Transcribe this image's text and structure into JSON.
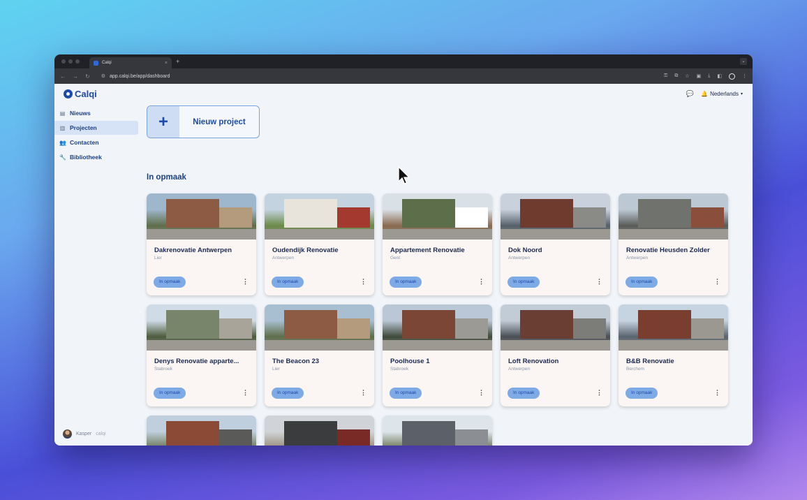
{
  "browser": {
    "tab_title": "Calqi",
    "tab_close": "×",
    "new_tab": "+",
    "url": "app.calqi.be/app/dashboard",
    "tabbar_menu": "⌄"
  },
  "app": {
    "logo": "Calqi",
    "nav": [
      {
        "label": "Nieuws",
        "icon": "newspaper-icon",
        "glyph": "▤"
      },
      {
        "label": "Projecten",
        "icon": "building-icon",
        "glyph": "▥",
        "active": true
      },
      {
        "label": "Contacten",
        "icon": "people-icon",
        "glyph": "👥"
      },
      {
        "label": "Bibliotheek",
        "icon": "wrench-icon",
        "glyph": "🔧"
      }
    ],
    "user": {
      "name": "Kasper",
      "org": "calqi"
    },
    "language": "Nederlands",
    "new_project_label": "Nieuw project",
    "new_project_plus": "+",
    "section_title": "In opmaak",
    "more_glyph": "⋮"
  },
  "projects": [
    {
      "title": "Dakrenovatie Antwerpen",
      "city": "Lier",
      "status": "In opmaak"
    },
    {
      "title": "Oudendijk Renovatie",
      "city": "Antwerpen",
      "status": "In opmaak"
    },
    {
      "title": "Appartement Renovatie",
      "city": "Gent",
      "status": "In opmaak"
    },
    {
      "title": "Dok Noord",
      "city": "Antwerpen",
      "status": "In opmaak"
    },
    {
      "title": "Renovatie Heusden Zolder",
      "city": "Antwerpen",
      "status": "In opmaak"
    },
    {
      "title": "Denys Renovatie apparte...",
      "city": "Stabroek",
      "status": "In opmaak"
    },
    {
      "title": "The Beacon 23",
      "city": "Lier",
      "status": "In opmaak"
    },
    {
      "title": "Poolhouse 1",
      "city": "Stabroek",
      "status": "In opmaak"
    },
    {
      "title": "Loft Renovation",
      "city": "Antwerpen",
      "status": "In opmaak"
    },
    {
      "title": "B&B Renovatie",
      "city": "Berchem",
      "status": "In opmaak"
    },
    {
      "title": "",
      "city": "",
      "status": ""
    },
    {
      "title": "",
      "city": "",
      "status": ""
    },
    {
      "title": "",
      "city": "",
      "status": ""
    }
  ],
  "colors": {
    "accent": "#1d4aa8",
    "status_badge": "#7eaae6",
    "active_nav": "#d6e2f6"
  }
}
